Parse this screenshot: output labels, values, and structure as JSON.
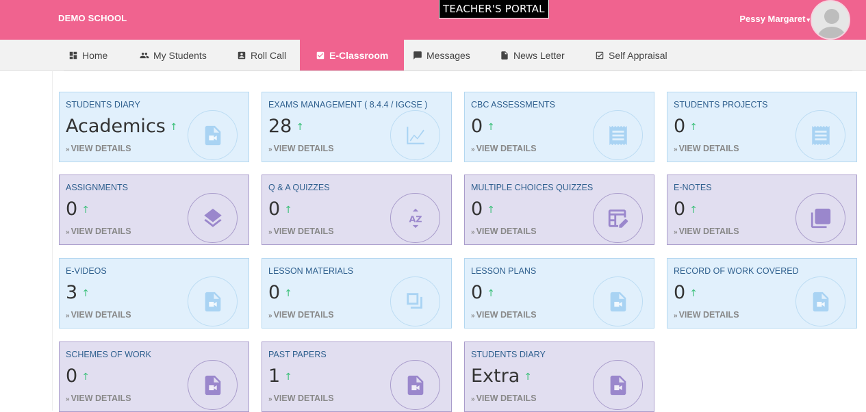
{
  "header": {
    "brand": "DEMO SCHOOL",
    "portal_title": "TEACHER'S PORTAL",
    "user_name": "Pessy Margaret",
    "user_caret": "▾"
  },
  "nav": [
    {
      "label": "Home",
      "icon": "dashboard-icon"
    },
    {
      "label": "My Students",
      "icon": "people-icon"
    },
    {
      "label": "Roll Call",
      "icon": "id-card-icon"
    },
    {
      "label": "E-Classroom",
      "icon": "check-box-icon",
      "active": true
    },
    {
      "label": "Messages",
      "icon": "chat-icon"
    },
    {
      "label": "News Letter",
      "icon": "document-icon"
    },
    {
      "label": "Self Appraisal",
      "icon": "check-box-outline-icon"
    }
  ],
  "cards": [
    {
      "title": "STUDENTS DIARY",
      "value": "Academics",
      "link": "VIEW DETAILS",
      "style": "blue",
      "icon": "video-file-icon"
    },
    {
      "title": "EXAMS MANAGEMENT ( 8.4.4 / IGCSE )",
      "value": "28",
      "link": "VIEW DETAILS",
      "style": "blue",
      "icon": "chart-icon"
    },
    {
      "title": "CBC ASSESSMENTS",
      "value": "0",
      "link": "VIEW DETAILS",
      "style": "blue",
      "icon": "receipt-icon"
    },
    {
      "title": "STUDENTS PROJECTS",
      "value": "0",
      "link": "VIEW DETAILS",
      "style": "blue",
      "icon": "receipt-icon"
    },
    {
      "title": "ASSIGNMENTS",
      "value": "0",
      "link": "VIEW DETAILS",
      "style": "purple",
      "icon": "layers-icon"
    },
    {
      "title": "Q & A QUIZZES",
      "value": "0",
      "link": "VIEW DETAILS",
      "style": "purple",
      "icon": "sort-az-icon"
    },
    {
      "title": "MULTIPLE CHOICES QUIZZES",
      "value": "0",
      "link": "VIEW DETAILS",
      "style": "purple",
      "icon": "table-edit-icon"
    },
    {
      "title": "E-NOTES",
      "value": "0",
      "link": "VIEW DETAILS",
      "style": "purple",
      "icon": "copy-icon"
    },
    {
      "title": "E-VIDEOS",
      "value": "3",
      "link": "VIEW DETAILS",
      "style": "blue",
      "icon": "video-file-icon"
    },
    {
      "title": "LESSON MATERIALS",
      "value": "0",
      "link": "VIEW DETAILS",
      "style": "blue",
      "icon": "flip-icon"
    },
    {
      "title": "LESSON PLANS",
      "value": "0",
      "link": "VIEW DETAILS",
      "style": "blue",
      "icon": "video-file-icon"
    },
    {
      "title": "RECORD OF WORK COVERED",
      "value": "0",
      "link": "VIEW DETAILS",
      "style": "blue",
      "icon": "video-file-icon"
    },
    {
      "title": "SCHEMES OF WORK",
      "value": "0",
      "link": "VIEW DETAILS",
      "style": "purple",
      "icon": "video-file-icon"
    },
    {
      "title": "PAST PAPERS",
      "value": "1",
      "link": "VIEW DETAILS",
      "style": "purple",
      "icon": "video-file-icon"
    },
    {
      "title": "STUDENTS DIARY",
      "value": "Extra",
      "link": "VIEW DETAILS",
      "style": "purple",
      "icon": "video-file-icon"
    }
  ],
  "colors": {
    "primary_pink": "#f0638f",
    "card_blue": "#e1f0fc",
    "card_purple": "#e1def0",
    "trend_up": "#3cc07a"
  }
}
